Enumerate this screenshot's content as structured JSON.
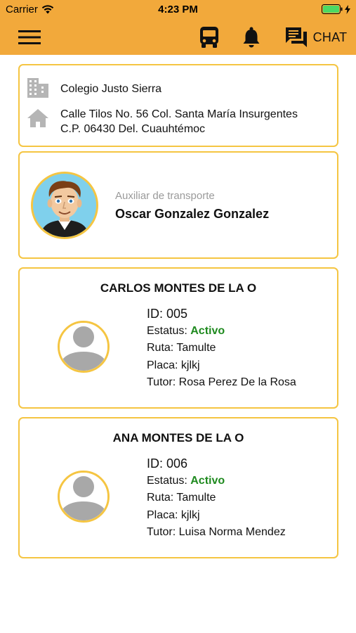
{
  "status_bar": {
    "carrier": "Carrier",
    "time": "4:23 PM"
  },
  "toolbar": {
    "menu_icon": "hamburger-icon",
    "bus_icon": "bus-icon",
    "bell_icon": "bell-icon",
    "chat_icon": "chat-icon",
    "chat_label": "CHAT"
  },
  "school": {
    "name": "Colegio Justo Sierra",
    "address_line1": "Calle Tilos No. 56 Col. Santa María Insurgentes",
    "address_line2": "C.P. 06430 Del. Cuauhtémoc"
  },
  "assistant": {
    "role": "Auxiliar de transporte",
    "name": "Oscar Gonzalez Gonzalez"
  },
  "labels": {
    "id": "ID: ",
    "status": "Estatus: ",
    "route": "Ruta: ",
    "plate": "Placa: ",
    "tutor": "Tutor: "
  },
  "students": [
    {
      "name": "CARLOS MONTES DE LA O",
      "id": "005",
      "status": "Activo",
      "route": "Tamulte",
      "plate": "kjlkj",
      "tutor": "Rosa Perez De la Rosa"
    },
    {
      "name": "ANA MONTES DE LA O",
      "id": "006",
      "status": "Activo",
      "route": "Tamulte",
      "plate": "kjlkj",
      "tutor": "Luisa Norma Mendez"
    }
  ],
  "colors": {
    "primary": "#f2a93b",
    "card_border": "#f5c542",
    "status_active": "#1f8a1f"
  }
}
